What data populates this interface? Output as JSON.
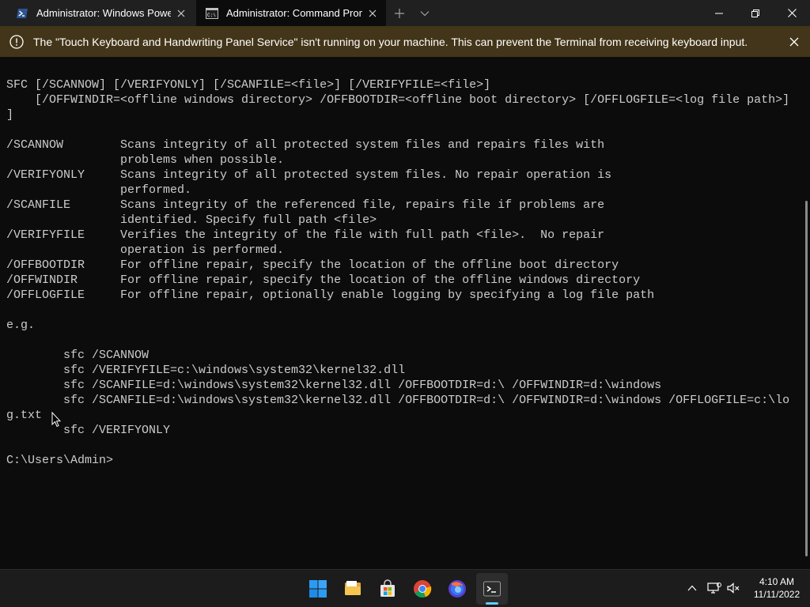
{
  "tabs": [
    {
      "title": "Administrator: Windows PowerShell",
      "icon": "powershell-icon",
      "active": false
    },
    {
      "title": "Administrator: Command Prompt",
      "icon": "command-prompt-icon",
      "active": true
    }
  ],
  "infobar": {
    "message": "The \"Touch Keyboard and Handwriting Panel Service\" isn't running on your machine. This can prevent the Terminal from receiving keyboard input.",
    "icon": "warning-icon"
  },
  "terminal": {
    "lines": [
      "SFC [/SCANNOW] [/VERIFYONLY] [/SCANFILE=<file>] [/VERIFYFILE=<file>]",
      "    [/OFFWINDIR=<offline windows directory> /OFFBOOTDIR=<offline boot directory> [/OFFLOGFILE=<log file path>]",
      "]",
      "",
      "/SCANNOW        Scans integrity of all protected system files and repairs files with",
      "                problems when possible.",
      "/VERIFYONLY     Scans integrity of all protected system files. No repair operation is",
      "                performed.",
      "/SCANFILE       Scans integrity of the referenced file, repairs file if problems are",
      "                identified. Specify full path <file>",
      "/VERIFYFILE     Verifies the integrity of the file with full path <file>.  No repair",
      "                operation is performed.",
      "/OFFBOOTDIR     For offline repair, specify the location of the offline boot directory",
      "/OFFWINDIR      For offline repair, specify the location of the offline windows directory",
      "/OFFLOGFILE     For offline repair, optionally enable logging by specifying a log file path",
      "",
      "e.g.",
      "",
      "        sfc /SCANNOW",
      "        sfc /VERIFYFILE=c:\\windows\\system32\\kernel32.dll",
      "        sfc /SCANFILE=d:\\windows\\system32\\kernel32.dll /OFFBOOTDIR=d:\\ /OFFWINDIR=d:\\windows",
      "        sfc /SCANFILE=d:\\windows\\system32\\kernel32.dll /OFFBOOTDIR=d:\\ /OFFWINDIR=d:\\windows /OFFLOGFILE=c:\\lo",
      "g.txt",
      "        sfc /VERIFYONLY",
      "",
      "C:\\Users\\Admin>"
    ]
  },
  "taskbar": {
    "apps": [
      "start-icon",
      "file-explorer-icon",
      "microsoft-store-icon",
      "chrome-icon",
      "firefox-icon",
      "terminal-icon"
    ],
    "active_app": "terminal-icon",
    "tray": [
      "chevron-up-icon",
      "network-icon",
      "volume-muted-icon"
    ],
    "time": "4:10 AM",
    "date": "11/11/2022"
  },
  "colors": {
    "terminal_bg": "#0c0c0c",
    "terminal_fg": "#cccccc",
    "tabbar_bg": "#202020",
    "infobar_bg": "#433519",
    "taskbar_bg": "#1c1c1c",
    "accent": "#60cdff"
  }
}
